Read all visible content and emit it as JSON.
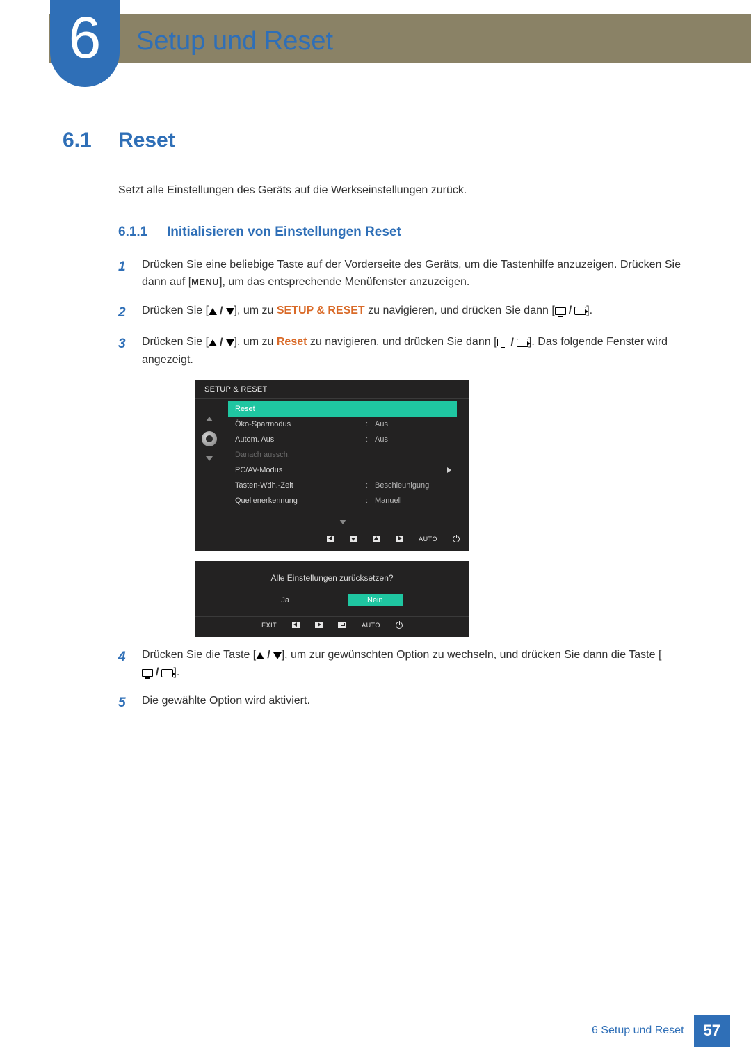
{
  "chapter": {
    "number": "6",
    "title": "Setup und Reset"
  },
  "section": {
    "number": "6.1",
    "title": "Reset",
    "intro": "Setzt alle Einstellungen des Geräts auf die Werkseinstellungen zurück."
  },
  "subsection": {
    "number": "6.1.1",
    "title": "Initialisieren von Einstellungen Reset"
  },
  "steps": {
    "s1": {
      "num": "1",
      "t1": "Drücken Sie eine beliebige Taste auf der Vorderseite des Geräts, um die Tastenhilfe anzuzeigen. Drücken Sie dann auf [",
      "menu": "MENU",
      "t2": "], um das entsprechende Menüfenster anzuzeigen."
    },
    "s2": {
      "num": "2",
      "t1": "Drücken Sie [",
      "t2": "], um zu ",
      "hl": "SETUP & RESET",
      "t3": " zu navigieren, und drücken Sie dann [",
      "t4": "]."
    },
    "s3": {
      "num": "3",
      "t1": "Drücken Sie [",
      "t2": "], um zu ",
      "hl": "Reset",
      "t3": " zu navigieren, und drücken Sie dann [",
      "t4": "]. Das folgende Fenster wird angezeigt."
    },
    "s4": {
      "num": "4",
      "t1": "Drücken Sie die Taste [",
      "t2": "], um zur gewünschten Option zu wechseln, und drücken Sie dann die Taste [",
      "t3": "]."
    },
    "s5": {
      "num": "5",
      "t1": "Die gewählte Option wird aktiviert."
    }
  },
  "osd1": {
    "title": "SETUP & RESET",
    "rows": {
      "reset": "Reset",
      "eco": "Öko-Sparmodus",
      "eco_v": "Aus",
      "auto": "Autom. Aus",
      "auto_v": "Aus",
      "after": "Danach aussch.",
      "pcav": "PC/AV-Modus",
      "repeat": "Tasten-Wdh.-Zeit",
      "repeat_v": "Beschleunigung",
      "source": "Quellenerkennung",
      "source_v": "Manuell"
    },
    "nav_auto": "AUTO"
  },
  "osd2": {
    "prompt": "Alle Einstellungen zurücksetzen?",
    "yes": "Ja",
    "no": "Nein",
    "exit": "EXIT",
    "auto": "AUTO"
  },
  "footer": {
    "text": "6 Setup und Reset",
    "page": "57"
  }
}
